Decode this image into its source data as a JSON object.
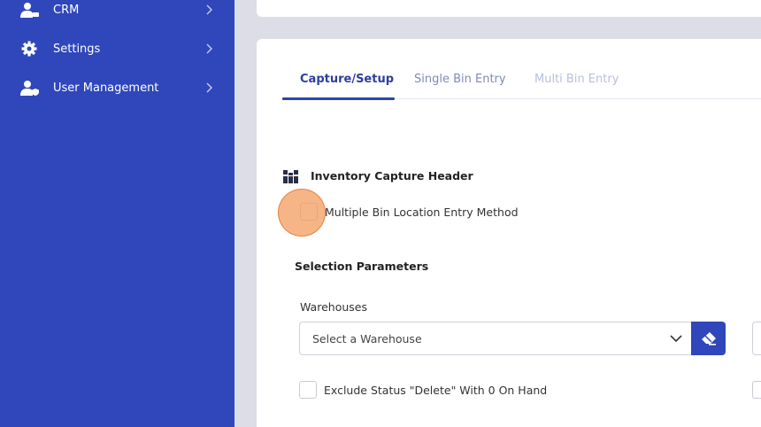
{
  "sidebar": {
    "items": [
      {
        "label": "CRM",
        "icon": "crm-user-icon"
      },
      {
        "label": "Settings",
        "icon": "gear-icon"
      },
      {
        "label": "User Management",
        "icon": "user-management-icon"
      }
    ]
  },
  "tabs": [
    {
      "label": "Capture/Setup",
      "active": true
    },
    {
      "label": "Single Bin Entry",
      "active": false
    },
    {
      "label": "Multi Bin Entry",
      "active": false
    }
  ],
  "capture_header": {
    "title": "Inventory Capture Header",
    "icon": "inventory-boxes-icon",
    "multiple_bin_label": "Multiple Bin Location Entry Method"
  },
  "selection": {
    "title": "Selection Parameters",
    "warehouses_label": "Warehouses",
    "warehouse_placeholder": "Select a Warehouse",
    "exclude_label": "Exclude Status \"Delete\" With 0 On Hand"
  },
  "colors": {
    "sidebar_bg": "#2f47bb",
    "accent": "#2c3f9e",
    "click_highlight": "#f39858"
  }
}
